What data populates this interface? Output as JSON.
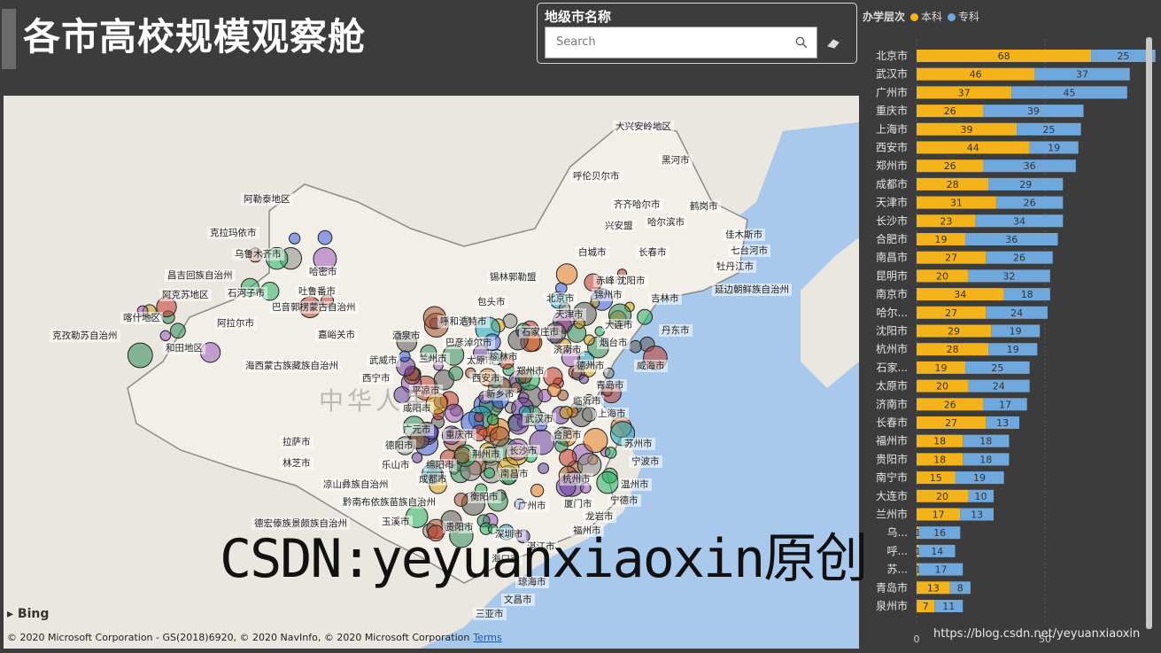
{
  "page": {
    "title": "各市高校规模观察舱"
  },
  "slicer": {
    "label": "地级市名称",
    "search_placeholder": "Search",
    "search_value": "",
    "search_icon": "search-icon",
    "clear_icon": "eraser-icon"
  },
  "map": {
    "country_label": "中华人民",
    "bing": "Bing",
    "copyright": "© 2020 Microsoft Corporation - GS(2018)6920, © 2020 NavInfo, © 2020 Microsoft Corporation",
    "terms": "Terms",
    "labels": [
      "大兴安岭地区",
      "黑河市",
      "呼伦贝尔市",
      "齐齐哈尔市",
      "鹤岗市",
      "兴安盟",
      "哈尔滨市",
      "佳木斯市",
      "阿勒泰地区",
      "克拉玛依市",
      "白城市",
      "七台河市",
      "乌鲁木齐市",
      "长春市",
      "牡丹江市",
      "昌吉回族自治州",
      "哈密市",
      "锡林郭勒盟",
      "赤峰市",
      "沈阳市",
      "阿克苏地区",
      "石河子市",
      "吐鲁番市",
      "北京市",
      "锦州市",
      "吉林市",
      "延边朝鲜族自治州",
      "巴音郭楞蒙古自治州",
      "包头市",
      "天津市",
      "喀什地区",
      "阿拉尔市",
      "呼和浩特市",
      "大连市",
      "丹东市",
      "克孜勒苏自治州",
      "嘉峪关市",
      "酒泉市",
      "石家庄市",
      "巴彦淖尔市",
      "和田地区",
      "济南市",
      "烟台市",
      "兰州市",
      "太原市",
      "武威市",
      "榆林市",
      "海西蒙古族藏族自治州",
      "西宁市",
      "郑州市",
      "德州市",
      "威海市",
      "西安市",
      "平凉市",
      "新乡市",
      "青岛市",
      "临沂市",
      "咸阳市",
      "上海市",
      "武汉市",
      "广元市",
      "合肥市",
      "重庆市",
      "苏州市",
      "拉萨市",
      "德阳市",
      "荆州市",
      "长沙市",
      "宁波市",
      "林芝市",
      "乐山市",
      "绵阳市",
      "南昌市",
      "杭州市",
      "成都市",
      "温州市",
      "凉山彝族自治州",
      "衡阳市",
      "宁德市",
      "黔南布依族苗族自治州",
      "广州市",
      "厦门市",
      "德宏傣族景颇族自治州",
      "龙岩市",
      "福州市",
      "玉溪市",
      "贵阳市",
      "深圳市",
      "湛江市",
      "海口市",
      "琼海市",
      "文昌市",
      "三亚市"
    ]
  },
  "chart_data": {
    "type": "bar",
    "orientation": "horizontal",
    "stacked": true,
    "legend_title": "办学层次",
    "legend_position": "top",
    "categories": [
      "北京市",
      "武汉市",
      "广州市",
      "重庆市",
      "上海市",
      "西安市",
      "郑州市",
      "成都市",
      "天津市",
      "长沙市",
      "合肥市",
      "南昌市",
      "昆明市",
      "南京市",
      "哈尔...",
      "沈阳市",
      "杭州市",
      "石家...",
      "太原市",
      "济南市",
      "长春市",
      "福州市",
      "贵阳市",
      "南宁市",
      "大连市",
      "兰州市",
      "乌...",
      "呼...",
      "苏...",
      "青岛市",
      "泉州市"
    ],
    "series": [
      {
        "name": "本科",
        "color": "#f5b31a",
        "values": [
          68,
          46,
          37,
          26,
          39,
          44,
          26,
          28,
          31,
          23,
          19,
          27,
          20,
          34,
          27,
          29,
          28,
          19,
          20,
          26,
          27,
          18,
          18,
          15,
          20,
          17,
          1,
          1,
          1,
          13,
          7
        ]
      },
      {
        "name": "专科",
        "color": "#6fa8dc",
        "values": [
          25,
          37,
          45,
          39,
          25,
          19,
          36,
          29,
          26,
          34,
          36,
          26,
          32,
          18,
          24,
          19,
          19,
          25,
          24,
          17,
          13,
          18,
          18,
          19,
          10,
          13,
          16,
          14,
          17,
          8,
          11
        ]
      }
    ],
    "x_ticks": [
      "0",
      "50",
      "100"
    ],
    "xlim": [
      0,
      100
    ]
  },
  "watermark": "CSDN:yeyuanxiaoxin原创",
  "footer": {
    "url": "https://blog.csdn.net/yeyuanxiaoxin"
  }
}
